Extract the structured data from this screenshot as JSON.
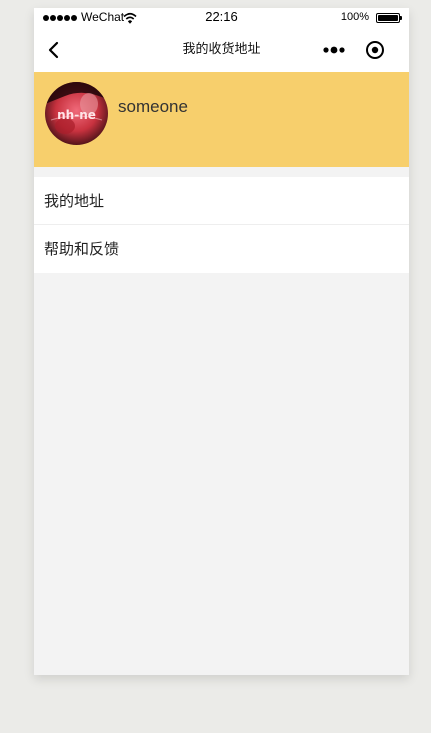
{
  "status_bar": {
    "carrier": "WeChat",
    "time": "22:16",
    "battery": "100%"
  },
  "nav": {
    "title": "我的收货地址",
    "back_icon": "chevron-left-icon",
    "more_icon": "more-dots-icon",
    "record_icon": "target-circle-icon"
  },
  "profile": {
    "username": "someone",
    "avatar_text": "nh-ne",
    "header_color": "#f7cf6c"
  },
  "menu": {
    "items": [
      {
        "label": "我的地址"
      },
      {
        "label": "帮助和反馈"
      }
    ]
  }
}
